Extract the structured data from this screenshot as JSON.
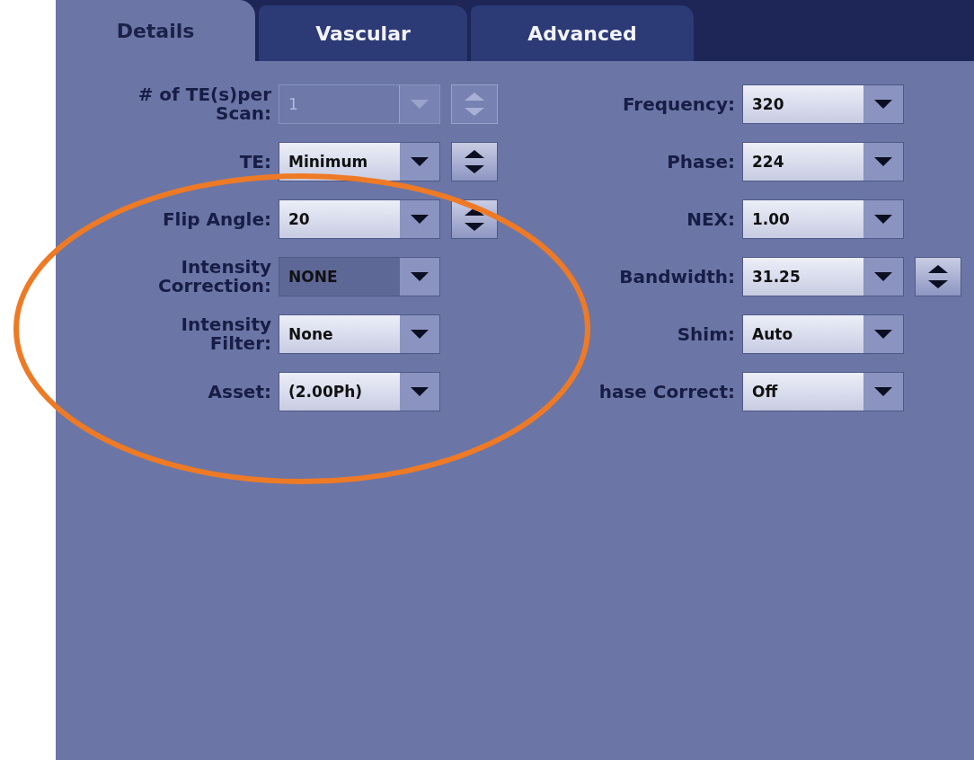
{
  "tabs": [
    {
      "label": "Details",
      "selected": true
    },
    {
      "label": "Vascular",
      "selected": false
    },
    {
      "label": "Advanced",
      "selected": false
    }
  ],
  "left_fields": [
    {
      "label": "# of TE(s)per\nScan:",
      "value": "1",
      "disabled": true,
      "dark": false,
      "spinner": true
    },
    {
      "label": "TE:",
      "value": "Minimum",
      "disabled": false,
      "dark": false,
      "spinner": true
    },
    {
      "label": "Flip Angle:",
      "value": "20",
      "disabled": false,
      "dark": false,
      "spinner": true
    },
    {
      "label": "Intensity\nCorrection:",
      "value": "NONE",
      "disabled": false,
      "dark": true,
      "spinner": false
    },
    {
      "label": "Intensity\nFilter:",
      "value": "None",
      "disabled": false,
      "dark": false,
      "spinner": false
    },
    {
      "label": "Asset:",
      "value": "(2.00Ph)",
      "disabled": false,
      "dark": false,
      "spinner": false
    }
  ],
  "right_fields": [
    {
      "label": "Frequency:",
      "value": "320",
      "disabled": false,
      "dark": false,
      "spinner": false
    },
    {
      "label": "Phase:",
      "value": "224",
      "disabled": false,
      "dark": false,
      "spinner": false
    },
    {
      "label": "NEX:",
      "value": "1.00",
      "disabled": false,
      "dark": false,
      "spinner": false
    },
    {
      "label": "Bandwidth:",
      "value": "31.25",
      "disabled": false,
      "dark": false,
      "spinner": true
    },
    {
      "label": "Shim:",
      "value": "Auto",
      "disabled": false,
      "dark": false,
      "spinner": false
    },
    {
      "label": "hase Correct:",
      "value": "Off",
      "disabled": false,
      "dark": false,
      "spinner": false
    }
  ]
}
